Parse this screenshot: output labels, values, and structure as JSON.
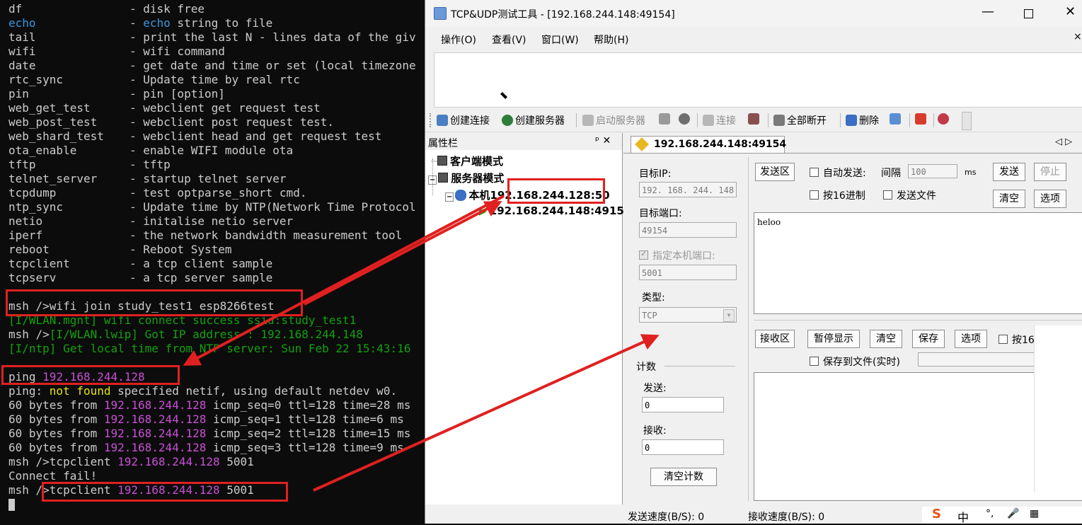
{
  "terminal": {
    "help_rows": [
      {
        "cmd": "df",
        "desc": "- disk free"
      },
      {
        "cmd": "echo",
        "desc": "- echo string to file"
      },
      {
        "cmd": "tail",
        "desc": "- print the last N - lines data of the giv"
      },
      {
        "cmd": "wifi",
        "desc": "- wifi command"
      },
      {
        "cmd": "date",
        "desc": "- get date and time or set (local timezone"
      },
      {
        "cmd": "rtc_sync",
        "desc": "- Update time by real rtc"
      },
      {
        "cmd": "pin",
        "desc": "- pin [option]"
      },
      {
        "cmd": "web_get_test",
        "desc": "- webclient get request test"
      },
      {
        "cmd": "web_post_test",
        "desc": "- webclient post request test."
      },
      {
        "cmd": "web_shard_test",
        "desc": "- webclient head and get request test"
      },
      {
        "cmd": "ota_enable",
        "desc": "- enable WIFI module ota"
      },
      {
        "cmd": "tftp",
        "desc": "- tftp"
      },
      {
        "cmd": "telnet_server",
        "desc": "- startup telnet server"
      },
      {
        "cmd": "tcpdump",
        "desc": "- test optparse_short cmd."
      },
      {
        "cmd": "ntp_sync",
        "desc": "- Update time by NTP(Network Time Protocol"
      },
      {
        "cmd": "netio",
        "desc": "- initalise netio server"
      },
      {
        "cmd": "iperf",
        "desc": "- the network bandwidth measurement tool"
      },
      {
        "cmd": "reboot",
        "desc": "- Reboot System"
      },
      {
        "cmd": "tcpclient",
        "desc": "- a tcp client sample"
      },
      {
        "cmd": "tcpserv",
        "desc": "- a tcp server sample"
      }
    ],
    "wifi_join": "msh />wifi join study_test1 esp8266test",
    "wlan_mgnt": "[I/WLAN.mgnt] wifi connect success ssid:study_test1",
    "msh_prompt": "msh />",
    "wlan_lwip": "[I/WLAN.lwip] Got IP address : 192.168.244.148",
    "ntp_line": "[I/ntp] Get local time from NTP server: Sun Feb 22 15:43:16",
    "ping_cmd": "ping ",
    "ping_ip": "192.168.244.128",
    "ping_prefix": "ping: ",
    "ping_notfound": "not found",
    "ping_suffix": " specified netif, using default netdev w0.",
    "bytes_from": "60 bytes from ",
    "replies": [
      " icmp_seq=0 ttl=128 time=28 ms",
      " icmp_seq=1 ttl=128 time=6 ms",
      " icmp_seq=2 ttl=128 time=15 ms",
      " icmp_seq=3 ttl=128 time=9 ms"
    ],
    "tcpclient_cmd": "msh />tcpclient ",
    "port": " 5001",
    "connect_fail": "Connect fail!",
    "msh_short": "msh /",
    "tcpclient_cmd2": ">tcpclient "
  },
  "app": {
    "title": "TCP&UDP测试工具 - [192.168.244.148:49154]",
    "menu": [
      "操作(O)",
      "查看(V)",
      "窗口(W)",
      "帮助(H)"
    ],
    "toolbar": {
      "create_conn": "创建连接",
      "create_server": "创建服务器",
      "start_server": "启动服务器",
      "connect": "连接",
      "disconnect_all": "全部断开",
      "delete": "删除"
    },
    "props_title": "属性栏",
    "props_pin": "ᵖ ✕",
    "tree": {
      "client_mode": "客户端模式",
      "server_mode": "服务器模式",
      "local_prefix": "本机",
      "local_addr": "192.168.244.128:50",
      "conn": "192.168.244.148:4915"
    },
    "tab_label": "192.168.244.148:49154",
    "tab_nav": "◁ ▷",
    "target_ip_label": "目标IP:",
    "target_ip": "192. 168. 244. 148",
    "target_port_label": "目标端口:",
    "target_port": "49154",
    "specify_local_port": "指定本机端口:",
    "local_port": "5001",
    "type_label": "类型:",
    "type_value": "TCP",
    "count_label": "计数",
    "send_label": "发送:",
    "send_count": "0",
    "recv_label": "接收:",
    "recv_count": "0",
    "clear_count": "清空计数",
    "send_area_btn": "发送区",
    "auto_send": "自动发送:",
    "interval_label": "间隔",
    "interval_value": "100",
    "ms": "ms",
    "send_btn": "发送",
    "stop_btn": "停止",
    "hex_send": "按16进制",
    "send_file": "发送文件",
    "clear_btn": "清空",
    "options_btn": "选项",
    "send_text": "heloo",
    "recv_area_btn": "接收区",
    "pause_display": "暂停显示",
    "recv_clear": "清空",
    "save": "保存",
    "recv_options": "选项",
    "hex_recv": "按16",
    "save_to_file": "保存到文件(实时)",
    "send_speed": "发送速度(B/S): 0",
    "recv_speed": "接收速度(B/S): 0",
    "ime_chars": [
      "S",
      "中",
      "°,",
      "🎤",
      "▦"
    ]
  },
  "colors": {
    "annotation_red": "#e02020",
    "terminal_bg": "#0c0c0c",
    "link_blue": "#3a96dd",
    "green": "#13a10e",
    "magenta": "#c94fd6"
  }
}
